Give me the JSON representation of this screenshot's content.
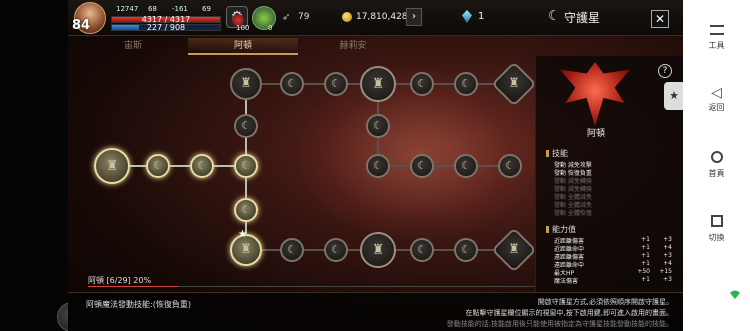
{
  "hud": {
    "level": "84",
    "small_stats": [
      "12747",
      "68",
      "-161",
      "69"
    ],
    "hp_text": "4317 / 4317",
    "hp_fill": 1.0,
    "mp_text": "227 / 908",
    "mp_fill": 0.25,
    "potion_count": "100",
    "herb_count": "0",
    "wings_value": "79",
    "gold_value": "17,810,428",
    "gem_value": "1",
    "title": "守護星",
    "close_label": "✕",
    "gold_arrow": "›"
  },
  "tabs": [
    {
      "label": "宙斯",
      "active": false
    },
    {
      "label": "阿頓",
      "active": true
    },
    {
      "label": "赫莉安",
      "active": false
    }
  ],
  "progress": {
    "label": "阿頓 [6/29] 20%",
    "fill": 0.2
  },
  "panel": {
    "help_label": "?",
    "crest_name": "阿頓",
    "skills_title": "技能",
    "skills": [
      {
        "text": "發動 減免攻擊",
        "active": true
      },
      {
        "text": "發動 恢復負重",
        "active": true
      },
      {
        "text": "發動 減免轉換",
        "active": false
      },
      {
        "text": "發動 減免轉換",
        "active": false
      },
      {
        "text": "發動 全體減免",
        "active": false
      },
      {
        "text": "發動 全體減免",
        "active": false
      },
      {
        "text": "發動 全體恢復",
        "active": false
      }
    ],
    "stats_title": "能力值",
    "stats": [
      {
        "name": "近距離傷害",
        "a": "+1",
        "b": "+3"
      },
      {
        "name": "近距離命中",
        "a": "+1",
        "b": "+4"
      },
      {
        "name": "遠距離傷害",
        "a": "+1",
        "b": "+3"
      },
      {
        "name": "遠距離命中",
        "a": "+1",
        "b": "+4"
      },
      {
        "name": "最大HP",
        "a": "+50",
        "b": "+15"
      },
      {
        "name": "魔法傷害",
        "a": "+1",
        "b": "+3"
      }
    ]
  },
  "bottom": {
    "skill_text": "阿頓魔法發動技能:(恢復負重)",
    "notes": [
      "開啟守護星方式,必須依照順序開啟守護星。",
      "在點擊守護星欄位顯示的視窗中,按下啟用鍵,即可進入啟用的畫面。",
      "發動技能的話,技能啟用後只能使用被指定為守護星技能發動技能的技能。"
    ]
  },
  "nav": {
    "tools": "工具",
    "back": "返回",
    "home": "首頁",
    "switch": "切換"
  },
  "colors": {
    "accent": "#c89a58",
    "hp": "#e03a3a",
    "mp": "#3a8ae0"
  }
}
